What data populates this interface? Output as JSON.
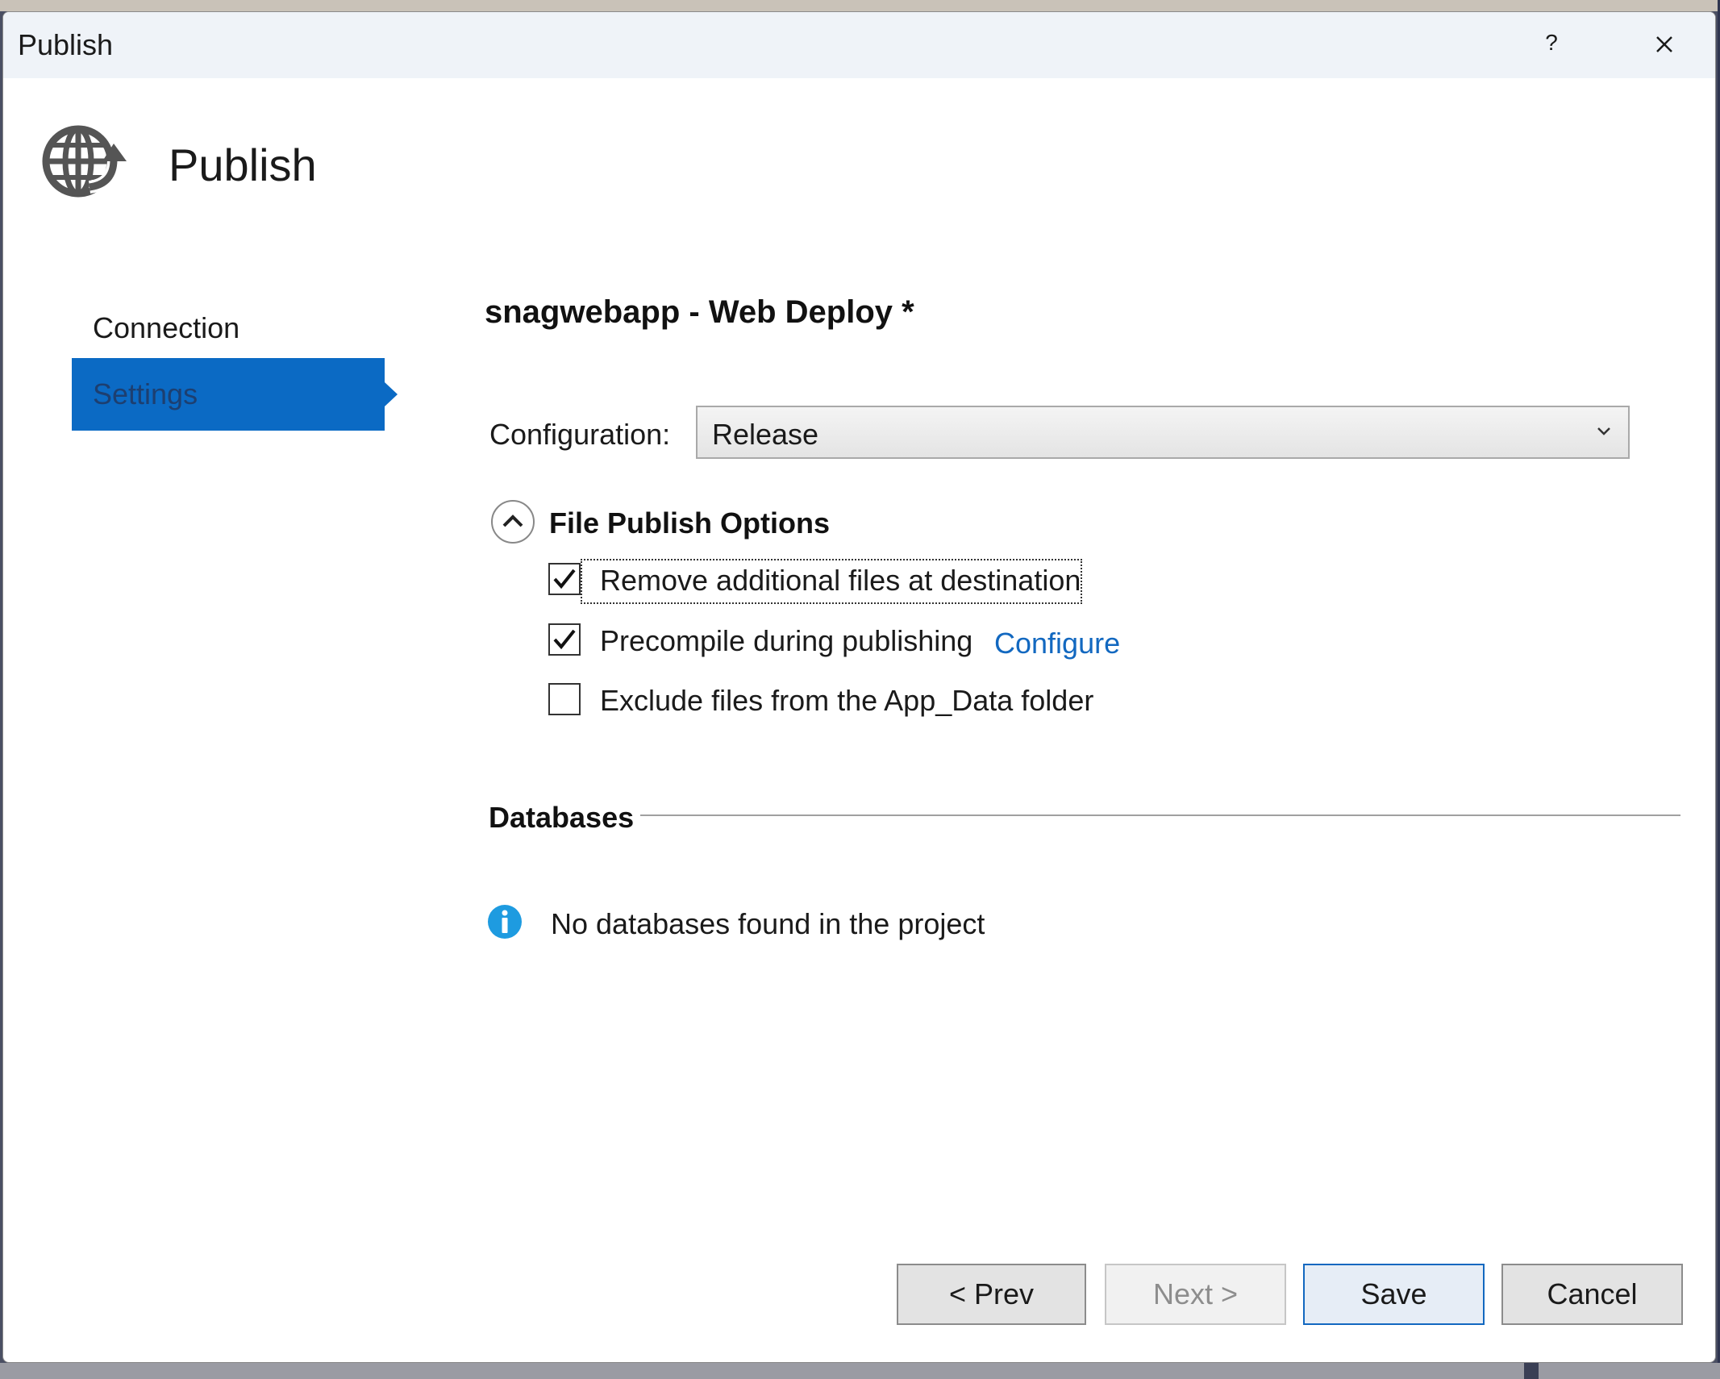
{
  "window": {
    "title": "Publish",
    "help_label": "?"
  },
  "header": {
    "title": "Publish",
    "icon": "globe-publish-icon"
  },
  "nav": {
    "items": [
      {
        "label": "Connection",
        "selected": false
      },
      {
        "label": "Settings",
        "selected": true
      }
    ]
  },
  "settings": {
    "profile_title": "snagwebapp - Web Deploy *",
    "configuration": {
      "label": "Configuration:",
      "value": "Release"
    },
    "file_publish_options": {
      "title": "File Publish Options",
      "expanded": true,
      "options": [
        {
          "label": "Remove additional files at destination",
          "checked": true,
          "focused": true
        },
        {
          "label": "Precompile during publishing",
          "checked": true,
          "link": "Configure"
        },
        {
          "label": "Exclude files from the App_Data folder",
          "checked": false
        }
      ]
    },
    "databases": {
      "title": "Databases",
      "message": "No databases found in the project"
    }
  },
  "footer": {
    "prev_label": "< Prev",
    "next_label": "Next >",
    "save_label": "Save",
    "cancel_label": "Cancel"
  },
  "colors": {
    "accent": "#0b6ac4",
    "link": "#1268c0",
    "info": "#1e9be0"
  }
}
